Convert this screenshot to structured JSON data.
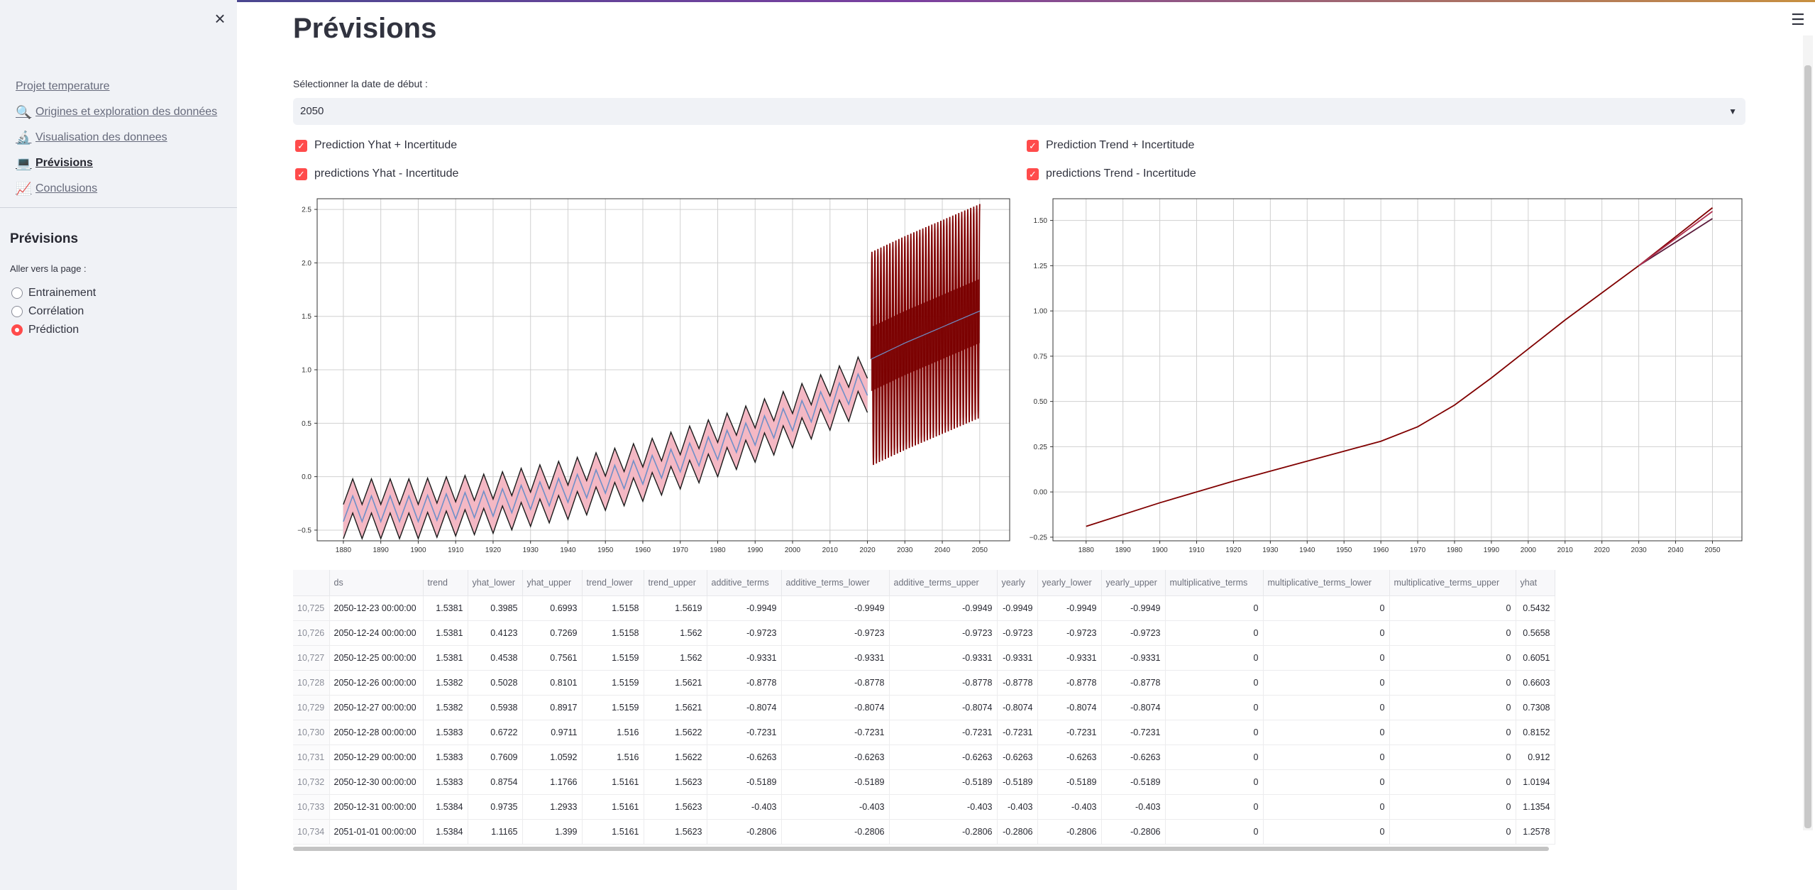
{
  "sidebar": {
    "close_icon": "close-icon",
    "nav": [
      {
        "label": "Projet temperature",
        "icon": ""
      },
      {
        "label": "Origines et exploration des données",
        "icon": "magnifier-icon"
      },
      {
        "label": "Visualisation des donnees",
        "icon": "microscope-icon"
      },
      {
        "label": "Prévisions",
        "icon": "laptop-icon",
        "active": true
      },
      {
        "label": "Conclusions",
        "icon": "chart-icon"
      }
    ],
    "section_title": "Prévisions",
    "radio_label": "Aller vers la page :",
    "radios": [
      {
        "label": "Entrainement",
        "selected": false
      },
      {
        "label": "Corrélation",
        "selected": false
      },
      {
        "label": "Prédiction",
        "selected": true
      }
    ]
  },
  "main": {
    "title": "Prévisions",
    "select_label": "Sélectionner la date de début :",
    "select_value": "2050",
    "checkboxes": [
      {
        "label": "Prediction Yhat + Incertitude",
        "checked": true
      },
      {
        "label": "predictions Yhat - Incertitude",
        "checked": true
      },
      {
        "label": "Prediction Trend + Incertitude",
        "checked": true
      },
      {
        "label": "predictions Trend - Incertitude",
        "checked": true
      }
    ]
  },
  "colors": {
    "accent": "#ff4b4b",
    "band": "#f4b8c4",
    "line_dark": "#800000",
    "yhat_line": "#6f8fc8"
  },
  "chart_data": [
    {
      "type": "line",
      "title": "",
      "xlabel": "",
      "ylabel": "",
      "xlim": [
        1873,
        2058
      ],
      "ylim": [
        -0.6,
        2.6
      ],
      "x_ticks": [
        "1880",
        "1890",
        "1900",
        "1910",
        "1920",
        "1930",
        "1940",
        "1950",
        "1960",
        "1970",
        "1980",
        "1990",
        "2000",
        "2010",
        "2020",
        "2030",
        "2040",
        "2050"
      ],
      "y_ticks": [
        "−0.5",
        "0.0",
        "0.5",
        "1.0",
        "1.5",
        "2.0",
        "2.5"
      ],
      "grid": true,
      "series": [
        {
          "x": [
            1880,
            1900,
            1920,
            1940,
            1960,
            1980,
            2000,
            2020
          ],
          "values": [
            -0.3,
            -0.3,
            -0.25,
            -0.12,
            0.05,
            0.28,
            0.55,
            0.88
          ]
        },
        {
          "x": [
            2021,
            2030,
            2040,
            2050
          ],
          "values": [
            1.1,
            1.25,
            1.4,
            1.55
          ]
        }
      ],
      "oscillation_amplitude_history": 0.12,
      "oscillation_amplitude_forecast": 1.0
    },
    {
      "type": "line",
      "title": "",
      "xlabel": "",
      "ylabel": "",
      "xlim": [
        1871,
        2058
      ],
      "ylim": [
        -0.27,
        1.62
      ],
      "x_ticks": [
        "1880",
        "1890",
        "1900",
        "1910",
        "1920",
        "1930",
        "1940",
        "1950",
        "1960",
        "1970",
        "1980",
        "1990",
        "2000",
        "2010",
        "2020",
        "2030",
        "2040",
        "2050"
      ],
      "y_ticks": [
        "−0.25",
        "0.00",
        "0.25",
        "0.50",
        "0.75",
        "1.00",
        "1.25",
        "1.50"
      ],
      "grid": true,
      "series": [
        {
          "x": [
            1880,
            1900,
            1920,
            1940,
            1960,
            1970,
            1980,
            1990,
            2000,
            2010,
            2020,
            2030
          ],
          "values": [
            -0.19,
            -0.06,
            0.06,
            0.17,
            0.28,
            0.36,
            0.48,
            0.63,
            0.79,
            0.95,
            1.1,
            1.25
          ]
        },
        {
          "x": [
            2030,
            2040,
            2050
          ],
          "values": [
            1.25,
            1.41,
            1.57
          ],
          "name": ""
        },
        {
          "x": [
            2030,
            2040,
            2050
          ],
          "values": [
            1.25,
            1.38,
            1.51
          ],
          "name": ""
        },
        {
          "x": [
            2030,
            2040,
            2050
          ],
          "values": [
            1.25,
            1.4,
            1.55
          ],
          "name": ""
        }
      ]
    }
  ],
  "table": {
    "columns": [
      "",
      "ds",
      "trend",
      "yhat_lower",
      "yhat_upper",
      "trend_lower",
      "trend_upper",
      "additive_terms",
      "additive_terms_lower",
      "additive_terms_upper",
      "yearly",
      "yearly_lower",
      "yearly_upper",
      "multiplicative_terms",
      "multiplicative_terms_lower",
      "multiplicative_terms_upper",
      "yhat"
    ],
    "rows": [
      [
        "10,725",
        "2050-12-23 00:00:00",
        "1.5381",
        "0.3985",
        "0.6993",
        "1.5158",
        "1.5619",
        "-0.9949",
        "-0.9949",
        "-0.9949",
        "-0.9949",
        "-0.9949",
        "-0.9949",
        "0",
        "0",
        "0",
        "0.5432"
      ],
      [
        "10,726",
        "2050-12-24 00:00:00",
        "1.5381",
        "0.4123",
        "0.7269",
        "1.5158",
        "1.562",
        "-0.9723",
        "-0.9723",
        "-0.9723",
        "-0.9723",
        "-0.9723",
        "-0.9723",
        "0",
        "0",
        "0",
        "0.5658"
      ],
      [
        "10,727",
        "2050-12-25 00:00:00",
        "1.5381",
        "0.4538",
        "0.7561",
        "1.5159",
        "1.562",
        "-0.9331",
        "-0.9331",
        "-0.9331",
        "-0.9331",
        "-0.9331",
        "-0.9331",
        "0",
        "0",
        "0",
        "0.6051"
      ],
      [
        "10,728",
        "2050-12-26 00:00:00",
        "1.5382",
        "0.5028",
        "0.8101",
        "1.5159",
        "1.5621",
        "-0.8778",
        "-0.8778",
        "-0.8778",
        "-0.8778",
        "-0.8778",
        "-0.8778",
        "0",
        "0",
        "0",
        "0.6603"
      ],
      [
        "10,729",
        "2050-12-27 00:00:00",
        "1.5382",
        "0.5938",
        "0.8917",
        "1.5159",
        "1.5621",
        "-0.8074",
        "-0.8074",
        "-0.8074",
        "-0.8074",
        "-0.8074",
        "-0.8074",
        "0",
        "0",
        "0",
        "0.7308"
      ],
      [
        "10,730",
        "2050-12-28 00:00:00",
        "1.5383",
        "0.6722",
        "0.9711",
        "1.516",
        "1.5622",
        "-0.7231",
        "-0.7231",
        "-0.7231",
        "-0.7231",
        "-0.7231",
        "-0.7231",
        "0",
        "0",
        "0",
        "0.8152"
      ],
      [
        "10,731",
        "2050-12-29 00:00:00",
        "1.5383",
        "0.7609",
        "1.0592",
        "1.516",
        "1.5622",
        "-0.6263",
        "-0.6263",
        "-0.6263",
        "-0.6263",
        "-0.6263",
        "-0.6263",
        "0",
        "0",
        "0",
        "0.912"
      ],
      [
        "10,732",
        "2050-12-30 00:00:00",
        "1.5383",
        "0.8754",
        "1.1766",
        "1.5161",
        "1.5623",
        "-0.5189",
        "-0.5189",
        "-0.5189",
        "-0.5189",
        "-0.5189",
        "-0.5189",
        "0",
        "0",
        "0",
        "1.0194"
      ],
      [
        "10,733",
        "2050-12-31 00:00:00",
        "1.5384",
        "0.9735",
        "1.2933",
        "1.5161",
        "1.5623",
        "-0.403",
        "-0.403",
        "-0.403",
        "-0.403",
        "-0.403",
        "-0.403",
        "0",
        "0",
        "0",
        "1.1354"
      ],
      [
        "10,734",
        "2051-01-01 00:00:00",
        "1.5384",
        "1.1165",
        "1.399",
        "1.5161",
        "1.5623",
        "-0.2806",
        "-0.2806",
        "-0.2806",
        "-0.2806",
        "-0.2806",
        "-0.2806",
        "0",
        "0",
        "0",
        "1.2578"
      ]
    ]
  }
}
